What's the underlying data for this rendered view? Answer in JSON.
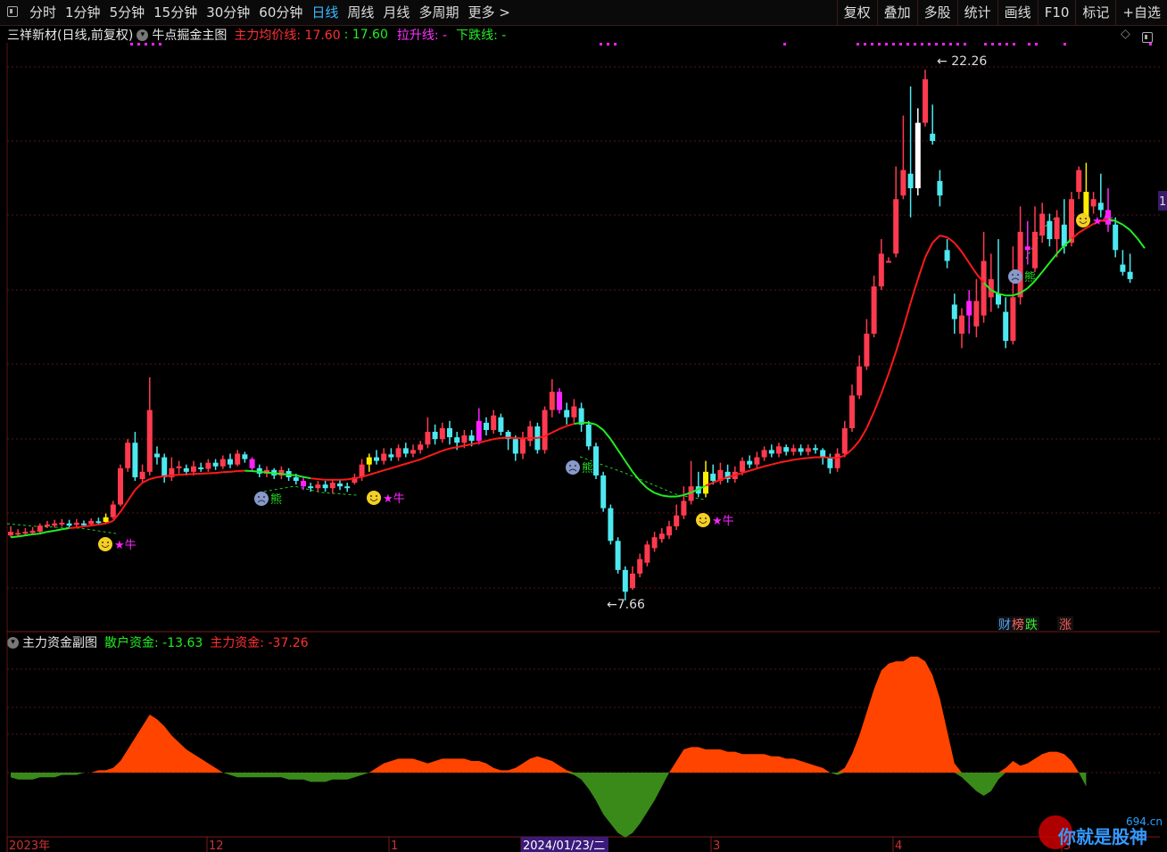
{
  "toolbar": {
    "periods": [
      "分时",
      "1分钟",
      "5分钟",
      "15分钟",
      "30分钟",
      "60分钟",
      "日线",
      "周线",
      "月线",
      "多周期",
      "更多 >"
    ],
    "active_period": "日线",
    "right_buttons": [
      "复权",
      "叠加",
      "多股",
      "统计",
      "画线",
      "F10",
      "标记",
      "+自选"
    ]
  },
  "header": {
    "stock": "三祥新材(日线,前复权)",
    "indicator": "牛点掘金主图",
    "ma_label": "主力均价线: 17.60",
    "ma_value2": ": 17.60",
    "up_label": "拉升线: -",
    "down_label": "下跌线: -"
  },
  "sub": {
    "title": "主力资金副图",
    "retail": "散户资金: -13.63",
    "main": "主力资金: -37.26"
  },
  "labels": {
    "high": "22.26",
    "low": "7.66",
    "bull": "牛",
    "bear": "熊",
    "legend_cai": "财",
    "legend_bang": "榜",
    "legend_die": "跌",
    "legend_zhang": "涨",
    "right_tag": "1"
  },
  "xaxis": {
    "labels": [
      "2023年",
      "12",
      "1",
      "2024/01/23/二",
      "3",
      "4",
      "5"
    ]
  },
  "watermark": {
    "site": "694.cn",
    "text": "你就是股神"
  },
  "colors": {
    "up": "#ff3a4f",
    "down": "#4de8f0",
    "ma": "#ff1a1a",
    "bull_line": "#22ee22",
    "magenta": "#ff22ff",
    "yellow": "#ffee00",
    "main_fund": "#ff4400",
    "retail_fund": "#3a8a1a"
  },
  "chart_data": {
    "type": "candlestick",
    "ylim": [
      7,
      23
    ],
    "high_mark": 22.26,
    "low_mark": 7.66,
    "candles": [
      [
        9.45,
        9.55,
        9.7,
        9.4
      ],
      [
        9.48,
        9.52,
        9.62,
        9.42
      ],
      [
        9.5,
        9.55,
        9.65,
        9.45
      ],
      [
        9.52,
        9.58,
        9.68,
        9.48
      ],
      [
        9.55,
        9.72,
        9.78,
        9.5
      ],
      [
        9.7,
        9.75,
        9.85,
        9.65
      ],
      [
        9.72,
        9.78,
        9.88,
        9.66
      ],
      [
        9.75,
        9.8,
        9.9,
        9.7
      ],
      [
        9.78,
        9.72,
        9.88,
        9.66
      ],
      [
        9.74,
        9.8,
        9.9,
        9.68
      ],
      [
        9.78,
        9.75,
        9.86,
        9.7
      ],
      [
        9.76,
        9.85,
        9.92,
        9.72
      ],
      [
        9.84,
        9.8,
        9.94,
        9.74
      ],
      [
        9.82,
        9.95,
        10.05,
        9.78
      ],
      [
        9.95,
        10.3,
        10.4,
        9.9
      ],
      [
        10.3,
        11.3,
        11.4,
        10.25
      ],
      [
        11.3,
        12.0,
        12.1,
        11.2
      ],
      [
        12.0,
        11.05,
        12.3,
        10.95
      ],
      [
        11.0,
        11.2,
        11.4,
        10.9
      ],
      [
        11.2,
        12.9,
        13.8,
        11.1
      ],
      [
        11.7,
        11.6,
        11.9,
        11.4
      ],
      [
        11.6,
        11.05,
        11.7,
        10.9
      ],
      [
        11.05,
        11.3,
        11.6,
        10.95
      ],
      [
        11.3,
        11.35,
        11.5,
        11.15
      ],
      [
        11.3,
        11.2,
        11.4,
        11.1
      ],
      [
        11.2,
        11.35,
        11.5,
        11.1
      ],
      [
        11.32,
        11.3,
        11.45,
        11.2
      ],
      [
        11.28,
        11.45,
        11.55,
        11.2
      ],
      [
        11.45,
        11.35,
        11.55,
        11.25
      ],
      [
        11.35,
        11.55,
        11.65,
        11.28
      ],
      [
        11.55,
        11.4,
        11.7,
        11.3
      ],
      [
        11.4,
        11.7,
        11.8,
        11.35
      ],
      [
        11.68,
        11.55,
        11.75,
        11.45
      ],
      [
        11.55,
        11.3,
        11.6,
        11.2
      ],
      [
        11.3,
        11.15,
        11.4,
        11.05
      ],
      [
        11.15,
        11.25,
        11.35,
        11.05
      ],
      [
        11.25,
        11.1,
        11.3,
        11.0
      ],
      [
        11.1,
        11.25,
        11.35,
        11.0
      ],
      [
        11.22,
        11.05,
        11.3,
        10.95
      ],
      [
        11.05,
        10.95,
        11.15,
        10.85
      ],
      [
        10.95,
        10.8,
        11.05,
        10.7
      ],
      [
        10.8,
        10.75,
        10.9,
        10.65
      ],
      [
        10.75,
        10.85,
        10.95,
        10.65
      ],
      [
        10.85,
        10.75,
        10.95,
        10.65
      ],
      [
        10.75,
        10.9,
        11.0,
        10.6
      ],
      [
        10.88,
        10.8,
        11.0,
        10.7
      ],
      [
        10.8,
        10.75,
        10.9,
        10.65
      ],
      [
        10.9,
        11.05,
        11.15,
        10.85
      ],
      [
        11.05,
        11.4,
        11.55,
        10.95
      ],
      [
        11.4,
        11.6,
        11.7,
        11.2
      ],
      [
        11.6,
        11.5,
        11.8,
        11.4
      ],
      [
        11.5,
        11.7,
        11.85,
        11.4
      ],
      [
        11.68,
        11.6,
        11.85,
        11.5
      ],
      [
        11.6,
        11.85,
        11.95,
        11.5
      ],
      [
        11.85,
        11.7,
        12.0,
        11.6
      ],
      [
        11.7,
        11.8,
        11.95,
        11.6
      ],
      [
        11.8,
        11.95,
        12.05,
        11.7
      ],
      [
        11.95,
        12.3,
        12.7,
        11.85
      ],
      [
        12.3,
        12.1,
        12.5,
        11.95
      ],
      [
        12.1,
        12.4,
        12.55,
        12.0
      ],
      [
        12.4,
        12.15,
        12.6,
        11.95
      ],
      [
        12.15,
        12.0,
        12.3,
        11.8
      ],
      [
        12.0,
        12.2,
        12.35,
        11.85
      ],
      [
        12.2,
        12.05,
        12.35,
        11.9
      ],
      [
        12.05,
        12.6,
        12.95,
        11.95
      ],
      [
        12.55,
        12.35,
        12.7,
        12.2
      ],
      [
        12.35,
        12.75,
        12.9,
        12.25
      ],
      [
        12.7,
        12.3,
        12.8,
        12.2
      ],
      [
        12.3,
        12.1,
        12.35,
        11.8
      ],
      [
        12.1,
        11.7,
        12.2,
        11.5
      ],
      [
        11.7,
        12.1,
        12.3,
        11.55
      ],
      [
        12.05,
        12.45,
        12.6,
        11.9
      ],
      [
        12.45,
        11.8,
        12.55,
        11.7
      ],
      [
        11.8,
        12.9,
        13.0,
        11.7
      ],
      [
        12.9,
        13.4,
        13.75,
        12.7
      ],
      [
        13.4,
        12.9,
        13.5,
        12.8
      ],
      [
        12.9,
        12.7,
        13.1,
        12.5
      ],
      [
        12.7,
        13.0,
        13.2,
        12.55
      ],
      [
        12.95,
        12.5,
        13.1,
        12.3
      ],
      [
        12.5,
        11.9,
        12.6,
        11.8
      ],
      [
        11.9,
        11.1,
        12.0,
        11.0
      ],
      [
        11.1,
        10.2,
        11.2,
        10.1
      ],
      [
        10.2,
        9.3,
        10.3,
        9.2
      ],
      [
        9.3,
        8.5,
        9.4,
        8.4
      ],
      [
        8.5,
        7.9,
        8.6,
        7.66
      ],
      [
        8.0,
        8.4,
        8.6,
        7.95
      ],
      [
        8.4,
        8.8,
        8.95,
        8.3
      ],
      [
        8.7,
        9.2,
        9.3,
        8.6
      ],
      [
        9.1,
        9.4,
        9.55,
        9.0
      ],
      [
        9.35,
        9.5,
        9.65,
        9.25
      ],
      [
        9.45,
        9.7,
        9.85,
        9.35
      ],
      [
        9.7,
        10.0,
        10.3,
        9.6
      ],
      [
        10.0,
        10.4,
        10.8,
        9.9
      ],
      [
        10.4,
        10.8,
        11.5,
        10.3
      ],
      [
        10.8,
        10.6,
        11.2,
        10.5
      ],
      [
        10.6,
        11.2,
        11.5,
        10.5
      ],
      [
        11.15,
        10.95,
        11.4,
        10.85
      ],
      [
        10.95,
        11.25,
        11.45,
        10.85
      ],
      [
        11.2,
        11.0,
        11.4,
        10.9
      ],
      [
        11.0,
        11.2,
        11.35,
        10.9
      ],
      [
        11.2,
        11.5,
        11.6,
        11.1
      ],
      [
        11.5,
        11.4,
        11.65,
        11.3
      ],
      [
        11.4,
        11.6,
        11.75,
        11.3
      ],
      [
        11.6,
        11.8,
        11.9,
        11.5
      ],
      [
        11.8,
        11.7,
        11.95,
        11.6
      ],
      [
        11.7,
        11.9,
        12.0,
        11.6
      ],
      [
        11.88,
        11.75,
        11.95,
        11.65
      ],
      [
        11.75,
        11.85,
        11.95,
        11.65
      ],
      [
        11.85,
        11.75,
        11.95,
        11.65
      ],
      [
        11.75,
        11.85,
        11.95,
        11.65
      ],
      [
        11.85,
        11.8,
        11.95,
        11.7
      ],
      [
        11.8,
        11.6,
        11.85,
        11.4
      ],
      [
        11.6,
        11.3,
        11.7,
        11.15
      ],
      [
        11.3,
        11.7,
        11.85,
        11.2
      ],
      [
        11.7,
        12.4,
        12.6,
        11.6
      ],
      [
        12.4,
        13.3,
        13.6,
        12.3
      ],
      [
        13.3,
        14.1,
        14.4,
        13.2
      ],
      [
        14.1,
        15.0,
        15.4,
        14.0
      ],
      [
        15.0,
        16.3,
        16.6,
        14.9
      ],
      [
        16.3,
        17.2,
        17.6,
        16.2
      ],
      [
        17.0,
        17.0,
        17.1,
        17.0
      ],
      [
        17.2,
        18.7,
        19.6,
        17.1
      ],
      [
        18.8,
        19.5,
        21.0,
        18.7
      ],
      [
        19.4,
        19.0,
        21.8,
        18.2
      ],
      [
        19.0,
        20.8,
        21.2,
        18.8
      ],
      [
        20.8,
        22.0,
        22.26,
        20.7
      ],
      [
        20.5,
        20.3,
        21.3,
        20.2
      ],
      [
        19.2,
        18.8,
        19.5,
        18.5
      ],
      [
        17.3,
        17.0,
        17.6,
        16.8
      ],
      [
        15.8,
        15.4,
        16.1,
        15.0
      ],
      [
        15.0,
        15.5,
        15.7,
        14.6
      ],
      [
        15.5,
        15.9,
        16.2,
        15.0
      ],
      [
        15.2,
        15.9,
        16.5,
        14.9
      ],
      [
        15.5,
        17.0,
        17.8,
        15.3
      ],
      [
        16.0,
        16.5,
        17.2,
        15.6
      ],
      [
        16.1,
        15.8,
        17.6,
        15.7
      ],
      [
        15.6,
        14.8,
        16.0,
        14.6
      ],
      [
        14.8,
        16.0,
        17.4,
        14.7
      ],
      [
        16.0,
        17.8,
        18.5,
        15.8
      ],
      [
        17.3,
        17.4,
        18.1,
        16.9
      ],
      [
        16.8,
        17.8,
        18.5,
        16.7
      ],
      [
        17.7,
        18.3,
        18.6,
        17.5
      ],
      [
        18.1,
        17.6,
        18.3,
        17.4
      ],
      [
        17.6,
        18.2,
        18.4,
        17.1
      ],
      [
        18.0,
        17.4,
        18.7,
        17.2
      ],
      [
        17.5,
        18.7,
        18.9,
        17.4
      ],
      [
        18.9,
        19.5,
        19.6,
        18.7
      ],
      [
        18.9,
        18.2,
        19.7,
        18.1
      ],
      [
        18.5,
        18.7,
        18.9,
        18.3
      ],
      [
        18.6,
        18.4,
        19.4,
        18.2
      ],
      [
        18.4,
        18.0,
        19.0,
        17.8
      ],
      [
        18.0,
        17.3,
        18.2,
        17.1
      ],
      [
        16.9,
        16.7,
        17.3,
        16.6
      ],
      [
        16.7,
        16.5,
        17.2,
        16.4
      ]
    ],
    "ma": [
      9.4,
      9.42,
      9.45,
      9.48,
      9.5,
      9.55,
      9.58,
      9.62,
      9.65,
      9.67,
      9.7,
      9.72,
      9.75,
      9.78,
      9.85,
      10.1,
      10.4,
      10.7,
      10.9,
      11.0,
      11.05,
      11.08,
      11.1,
      11.12,
      11.13,
      11.14,
      11.15,
      11.16,
      11.17,
      11.19,
      11.2,
      11.22,
      11.23,
      11.22,
      11.2,
      11.18,
      11.16,
      11.14,
      11.12,
      11.1,
      11.06,
      11.02,
      11.0,
      10.98,
      10.98,
      10.98,
      10.99,
      11.02,
      11.06,
      11.12,
      11.18,
      11.24,
      11.3,
      11.36,
      11.42,
      11.48,
      11.54,
      11.62,
      11.7,
      11.78,
      11.84,
      11.88,
      11.92,
      11.96,
      12.0,
      12.05,
      12.1,
      12.13,
      12.14,
      12.13,
      12.12,
      12.13,
      12.13,
      12.18,
      12.28,
      12.38,
      12.46,
      12.52,
      12.55,
      12.55,
      12.5,
      12.35,
      12.1,
      11.8,
      11.5,
      11.2,
      10.95,
      10.75,
      10.62,
      10.55,
      10.52,
      10.52,
      10.56,
      10.63,
      10.72,
      10.82,
      10.9,
      10.98,
      11.05,
      11.11,
      11.17,
      11.23,
      11.29,
      11.35,
      11.4,
      11.45,
      11.49,
      11.53,
      11.56,
      11.58,
      11.6,
      11.6,
      11.59,
      11.58,
      11.65,
      11.82,
      12.05,
      12.4,
      12.85,
      13.35,
      13.9,
      14.5,
      15.15,
      15.85,
      16.5,
      17.1,
      17.5,
      17.7,
      17.65,
      17.5,
      17.25,
      16.95,
      16.65,
      16.4,
      16.2,
      16.1,
      16.05,
      16.05,
      16.12,
      16.25,
      16.45,
      16.7,
      16.95,
      17.2,
      17.42,
      17.6,
      17.78,
      17.9,
      18.02,
      18.1,
      18.15,
      18.1,
      18.0,
      17.85,
      17.62,
      17.35
    ],
    "fund_main": [
      -2,
      -3,
      -3,
      -3,
      -2,
      -2,
      -2,
      -1,
      -1,
      -1,
      0,
      0,
      1,
      1,
      2,
      5,
      10,
      15,
      20,
      25,
      23,
      20,
      16,
      13,
      10,
      8,
      6,
      4,
      2,
      0,
      -1,
      -2,
      -2,
      -2,
      -2,
      -2,
      -2,
      -2,
      -3,
      -3,
      -3,
      -4,
      -4,
      -4,
      -3,
      -3,
      -3,
      -2,
      -1,
      0,
      2,
      4,
      5,
      6,
      6,
      6,
      5,
      4,
      5,
      6,
      6,
      6,
      6,
      5,
      5,
      4,
      2,
      1,
      1,
      2,
      4,
      6,
      7,
      6,
      5,
      3,
      1,
      -1,
      -3,
      -7,
      -12,
      -18,
      -22,
      -26,
      -28,
      -26,
      -22,
      -17,
      -12,
      -6,
      0,
      5,
      10,
      11,
      11,
      10,
      10,
      10,
      9,
      9,
      8,
      8,
      8,
      8,
      7,
      7,
      6,
      6,
      5,
      4,
      3,
      2,
      0,
      -1,
      2,
      8,
      16,
      26,
      36,
      44,
      47,
      48,
      48,
      50,
      50,
      48,
      42,
      32,
      18,
      4,
      -2,
      -5,
      -8,
      -10,
      -8,
      -3,
      2,
      5,
      3,
      4,
      6,
      8,
      9,
      9,
      8,
      5,
      0,
      -6
    ]
  }
}
